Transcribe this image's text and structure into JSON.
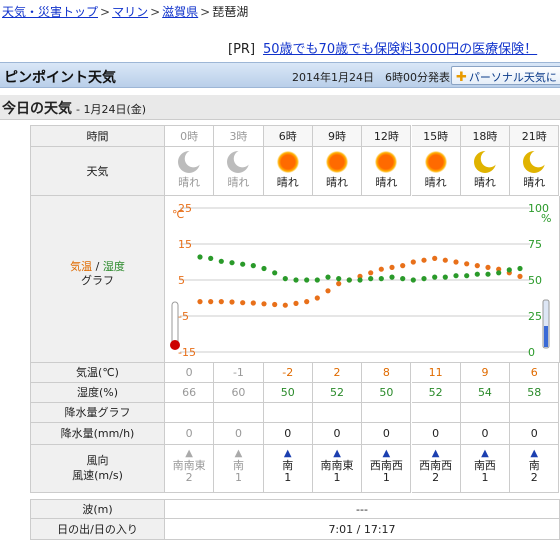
{
  "breadcrumb": {
    "items": [
      "天気・災害トップ",
      "マリン",
      "滋賀県"
    ],
    "current": "琵琶湖",
    "separator": ">"
  },
  "ad": {
    "tag": "[PR]",
    "text": "50歳でも70歳でも保険料3000円の医療保険！"
  },
  "header": {
    "title": "ピンポイント天気",
    "issued": "2014年1月24日　6時00分発表",
    "button": "パーソナル天気に"
  },
  "today": {
    "title": "今日の天気",
    "date": "- 1月24日(金)"
  },
  "labels": {
    "time": "時間",
    "weather": "天気",
    "graph_temp": "気温",
    "graph_slash": " / ",
    "graph_hum": "湿度",
    "graph_word": "グラフ",
    "temp": "気温(℃)",
    "humidity": "湿度(%)",
    "precip_graph": "降水量グラフ",
    "precip": "降水量(mm/h)",
    "wind_dir": "風向",
    "wind_speed": "風速(m/s)",
    "wave": "波(m)",
    "sun": "日の出/日の入り"
  },
  "hours": [
    "0時",
    "3時",
    "6時",
    "9時",
    "12時",
    "15時",
    "18時",
    "21時"
  ],
  "weather": [
    "晴れ",
    "晴れ",
    "晴れ",
    "晴れ",
    "晴れ",
    "晴れ",
    "晴れ",
    "晴れ"
  ],
  "weather_icons": [
    "moon-icon",
    "moon-icon",
    "sun-icon",
    "sun-icon",
    "sun-icon",
    "sun-icon",
    "moon-icon",
    "moon-icon"
  ],
  "temp": [
    "0",
    "-1",
    "-2",
    "2",
    "8",
    "11",
    "9",
    "6"
  ],
  "humidity": [
    "66",
    "60",
    "50",
    "52",
    "50",
    "52",
    "54",
    "58"
  ],
  "precip": [
    "0",
    "0",
    "0",
    "0",
    "0",
    "0",
    "0",
    "0"
  ],
  "wind_dir": [
    "南南東",
    "南",
    "南",
    "南南東",
    "西南西",
    "西南西",
    "南西",
    "南"
  ],
  "wind_speed": [
    "2",
    "1",
    "1",
    "1",
    "1",
    "2",
    "1",
    "2"
  ],
  "wave": "---",
  "sunrise_sunset": "7:01 / 17:17",
  "chart_data": {
    "type": "line",
    "left_axis": {
      "unit": "℃",
      "ticks": [
        "25",
        "15",
        "5",
        "-5",
        "-15"
      ],
      "ylim": [
        -15,
        25
      ]
    },
    "right_axis": {
      "unit": "%",
      "ticks": [
        "100",
        "75",
        "50",
        "25",
        "0"
      ],
      "ylim": [
        0,
        100
      ]
    },
    "series": [
      {
        "axis": "left",
        "color": "#e8701a",
        "values": [
          -1,
          -1,
          -1,
          -1.1,
          -1.3,
          -1.4,
          -1.6,
          -1.8,
          -2,
          -1.5,
          -1,
          0,
          2,
          4,
          5,
          6,
          7,
          8,
          8.5,
          9,
          10,
          10.5,
          11,
          10.5,
          10,
          9.5,
          9,
          8.5,
          8,
          7,
          6
        ]
      },
      {
        "axis": "right",
        "color": "#2a9a2a",
        "values": [
          66,
          65,
          63,
          62,
          61,
          60,
          58,
          55,
          51,
          50,
          50,
          50,
          52,
          51,
          50,
          50,
          51,
          51,
          52,
          51,
          50,
          51,
          52,
          52,
          53,
          53,
          54,
          54,
          55,
          57,
          58
        ]
      }
    ],
    "grid": true,
    "colors": {
      "temp_gauge": "#cc0000",
      "hum_gauge": "#3a6ad6",
      "grid": "#cccccc"
    }
  }
}
